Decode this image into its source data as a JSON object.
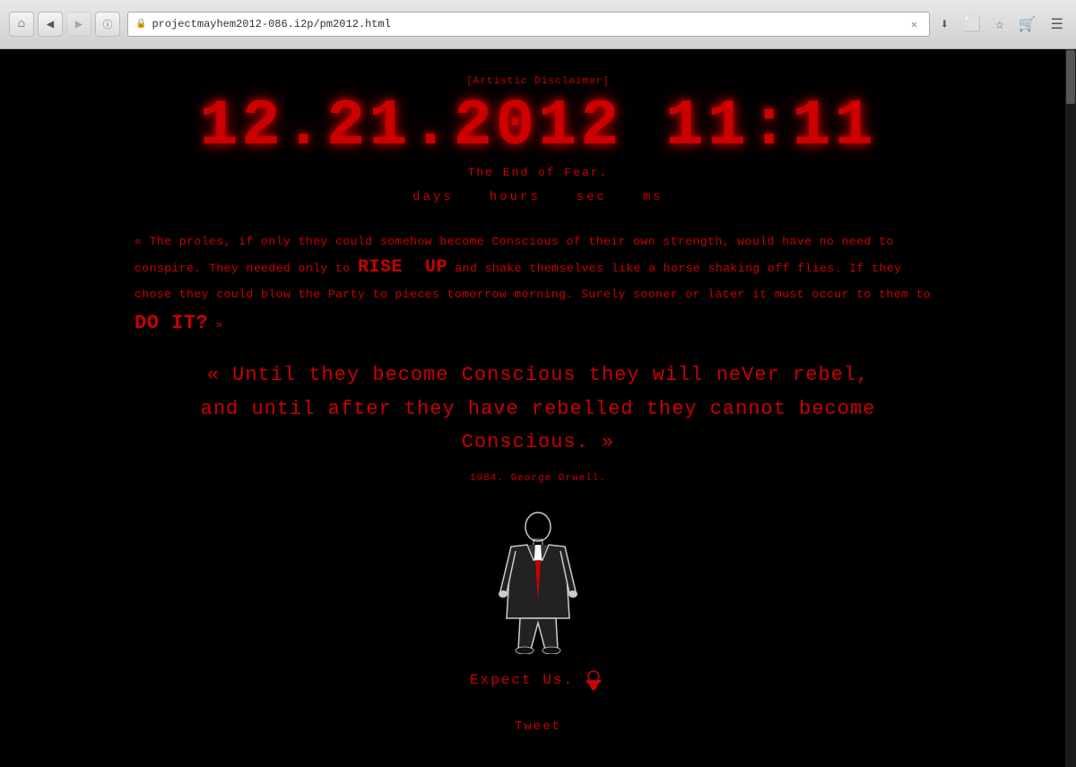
{
  "browser": {
    "url_protocol": "i",
    "url_domain": "projectmayhem2012-086.i2p",
    "url_path": "/pm2012.html",
    "close_icon": "✕",
    "download_icon": "⬇",
    "bookmark_icon": "☆",
    "reading_icon": "♥",
    "cart_icon": "🛒",
    "menu_icon": "☰"
  },
  "page": {
    "disclaimer": "[Artistic Disclaimer]",
    "clock": "12.21.2012  11:11",
    "tagline": "The End of Fear.",
    "countdown": {
      "days": "days",
      "hours": "hours",
      "sec": "sec",
      "ms": "ms"
    },
    "paragraph": "« The proles, if only they could somehow become Conscious of their own strength, would have no need to conspire. They needed only to RISE UP and shake themselves like a horse shaking off flies. If they chose they could blow the Party to pieces tomorrow morning. Surely sooner or later it must occur to them to DO IT? »",
    "big_quote_line1": "« Until they become Conscious they will neVer rebel,",
    "big_quote_line2": "and until after they have rebelled they cannot become Conscious. »",
    "attribution": "1984. George Orwell.",
    "expect_us": "Expect Us.",
    "tweet": "Tweet"
  }
}
